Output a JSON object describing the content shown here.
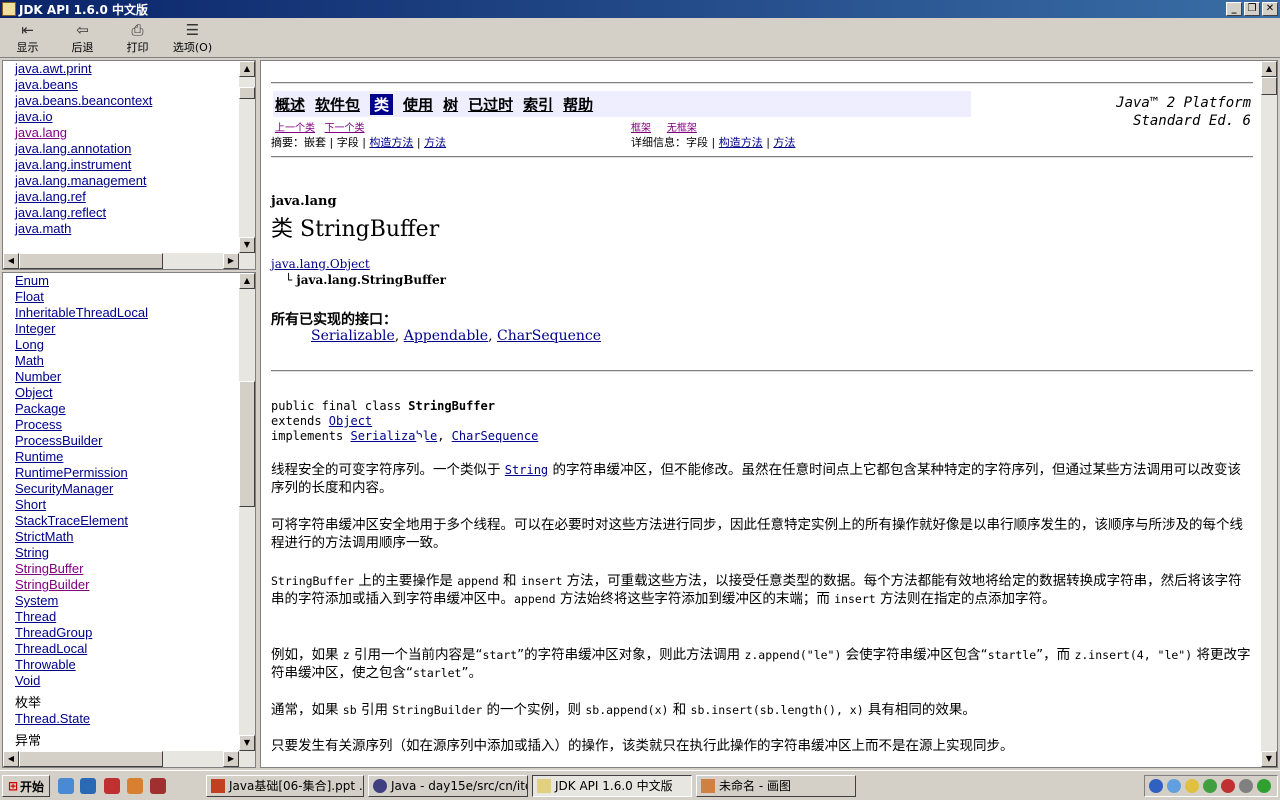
{
  "window": {
    "title": "JDK API 1.6.0 中文版"
  },
  "toolbar": [
    {
      "label": "显示",
      "icon": "show-icon"
    },
    {
      "label": "后退",
      "icon": "back-icon"
    },
    {
      "label": "打印",
      "icon": "print-icon"
    },
    {
      "label": "选项(O)",
      "icon": "options-icon"
    }
  ],
  "packages": [
    "java.awt.print",
    "java.beans",
    "java.beans.beancontext",
    "java.io",
    "java.lang",
    "java.lang.annotation",
    "java.lang.instrument",
    "java.lang.management",
    "java.lang.ref",
    "java.lang.reflect",
    "java.math"
  ],
  "classes": [
    "Enum",
    "Float",
    "InheritableThreadLocal",
    "Integer",
    "Long",
    "Math",
    "Number",
    "Object",
    "Package",
    "Process",
    "ProcessBuilder",
    "Runtime",
    "RuntimePermission",
    "SecurityManager",
    "Short",
    "StackTraceElement",
    "StrictMath",
    "String",
    "StringBuffer",
    "StringBuilder",
    "System",
    "Thread",
    "ThreadGroup",
    "ThreadLocal",
    "Throwable",
    "Void"
  ],
  "enum_heading": "枚举",
  "enums": [
    "Thread.State"
  ],
  "exception_heading": "异常",
  "nav": {
    "items": [
      "概述",
      "软件包",
      "类",
      "使用",
      "树",
      "已过时",
      "索引",
      "帮助"
    ],
    "prev_class": "上一个类",
    "next_class": "下一个类",
    "frames": "框架",
    "no_frames": "无框架",
    "summary": "摘要：嵌套 | 字段 |",
    "summary_ctor": "构造方法",
    "summary_method": "方法",
    "detail": "详细信息：字段 |",
    "detail_ctor": "构造方法",
    "detail_method": "方法",
    "platform_1": "Java™ 2 Platform",
    "platform_2": "Standard Ed. 6"
  },
  "doc": {
    "package": "java.lang",
    "class_title": "类 StringBuffer",
    "parent": "java.lang.Object",
    "self": "java.lang.StringBuffer",
    "interfaces_heading": "所有已实现的接口：",
    "interfaces": [
      "Serializable",
      "Appendable",
      "CharSequence"
    ],
    "decl_1": "public final class ",
    "decl_name": "StringBuffer",
    "decl_extends": "extends ",
    "decl_object": "Object",
    "decl_implements": "implements ",
    "decl_ser": "Serializable",
    "decl_cs": "CharSequence",
    "p1a": "线程安全的可变字符序列。一个类似于 ",
    "p1_link": "String",
    "p1b": " 的字符串缓冲区，但不能修改。虽然在任意时间点上它都包含某种特定的字符序列，但通过某些方法调用可以改变该序列的长度和内容。",
    "p2": "可将字符串缓冲区安全地用于多个线程。可以在必要时对这些方法进行同步，因此任意特定实例上的所有操作就好像是以串行顺序发生的，该顺序与所涉及的每个线程进行的方法调用顺序一致。",
    "p3_code1": "StringBuffer",
    "p3a": " 上的主要操作是 ",
    "p3_code2": "append",
    "p3b": " 和 ",
    "p3_code3": "insert",
    "p3c": " 方法，可重载这些方法，以接受任意类型的数据。每个方法都能有效地将给定的数据转换成字符串，然后将该字符串的字符添加或插入到字符串缓冲区中。",
    "p3_code4": "append",
    "p3d": " 方法始终将这些字符添加到缓冲区的末端；而 ",
    "p3_code5": "insert",
    "p3e": " 方法则在指定的点添加字符。",
    "p4a": "例如，如果 ",
    "p4_z": "z",
    "p4b": " 引用一个当前内容是“",
    "p4_start": "start",
    "p4c": "”的字符串缓冲区对象，则此方法调用 ",
    "p4_code1": "z.append(\"le\")",
    "p4d": " 会使字符串缓冲区包含“",
    "p4_startle": "startle",
    "p4e": "”，而 ",
    "p4_code2": "z.insert(4, \"le\")",
    "p4f": " 将更改字符串缓冲区，使之包含“",
    "p4_starlet": "starlet",
    "p4g": "”。",
    "p5a": "通常，如果 ",
    "p5_sb": "sb",
    "p5b": " 引用 ",
    "p5_sbld": "StringBuilder",
    "p5c": " 的一个实例，则 ",
    "p5_c1": "sb.append(x)",
    "p5d": " 和 ",
    "p5_c2": "sb.insert(sb.length(), x)",
    "p5e": " 具有相同的效果。",
    "p6": "只要发生有关源序列（如在源序列中添加或插入）的操作，该类就只在执行此操作的字符串缓冲区上而不是在源上实现同步。"
  },
  "taskbar": {
    "start": "开始",
    "tasks": [
      "Java基础[06-集合].ppt ...",
      "Java - day15e/src/cn/itc...",
      "JDK API 1.6.0 中文版",
      "未命名 - 画图"
    ]
  }
}
